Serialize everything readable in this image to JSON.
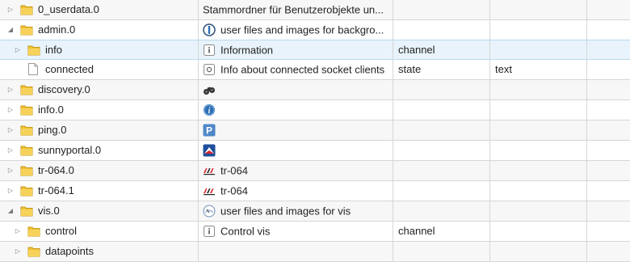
{
  "rows": [
    {
      "name": "0_userdata.0",
      "desc": "Stammordner für Benutzerobjekte un...",
      "type": "",
      "role": "",
      "expanded": false,
      "icon": "folder-icon",
      "desc_icon": ""
    },
    {
      "name": "admin.0",
      "desc": "user files and images for backgro...",
      "type": "",
      "role": "",
      "expanded": true,
      "icon": "folder-icon",
      "desc_icon": "admin-logo-icon"
    },
    {
      "name": "info",
      "desc": "Information",
      "type": "channel",
      "role": "",
      "expanded": false,
      "icon": "folder-icon",
      "desc_icon": "info-box-icon"
    },
    {
      "name": "connected",
      "desc": "Info about connected socket clients",
      "type": "state",
      "role": "text",
      "expanded": false,
      "icon": "file-icon",
      "desc_icon": "state-box-icon"
    },
    {
      "name": "discovery.0",
      "desc": "",
      "type": "",
      "role": "",
      "expanded": false,
      "icon": "folder-icon",
      "desc_icon": "binoculars-icon"
    },
    {
      "name": "info.0",
      "desc": "",
      "type": "",
      "role": "",
      "expanded": false,
      "icon": "folder-icon",
      "desc_icon": "info-circle-icon"
    },
    {
      "name": "ping.0",
      "desc": "",
      "type": "",
      "role": "",
      "expanded": false,
      "icon": "folder-icon",
      "desc_icon": "ping-p-icon"
    },
    {
      "name": "sunnyportal.0",
      "desc": "",
      "type": "",
      "role": "",
      "expanded": false,
      "icon": "folder-icon",
      "desc_icon": "sunnyportal-icon"
    },
    {
      "name": "tr-064.0",
      "desc": "tr-064",
      "type": "",
      "role": "",
      "expanded": false,
      "icon": "folder-icon",
      "desc_icon": "avm-logo-icon"
    },
    {
      "name": "tr-064.1",
      "desc": "tr-064",
      "type": "",
      "role": "",
      "expanded": false,
      "icon": "folder-icon",
      "desc_icon": "avm-logo-icon"
    },
    {
      "name": "vis.0",
      "desc": "user files and images for vis",
      "type": "",
      "role": "",
      "expanded": true,
      "icon": "folder-icon",
      "desc_icon": "vis-gauge-icon"
    },
    {
      "name": "control",
      "desc": "Control vis",
      "type": "channel",
      "role": "",
      "expanded": false,
      "icon": "folder-icon",
      "desc_icon": "info-box-icon"
    },
    {
      "name": "datapoints",
      "desc": "",
      "type": "",
      "role": "",
      "expanded": false,
      "icon": "folder-icon",
      "desc_icon": ""
    }
  ],
  "colors": {
    "folder": "#e8b92e",
    "selected_row": "#e8f3fb",
    "accent_blue": "#2c6fb5"
  }
}
